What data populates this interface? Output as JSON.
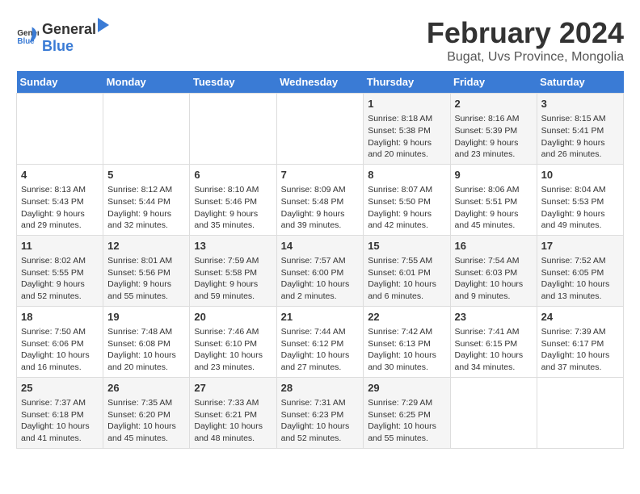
{
  "logo": {
    "general": "General",
    "blue": "Blue"
  },
  "title": "February 2024",
  "subtitle": "Bugat, Uvs Province, Mongolia",
  "days_of_week": [
    "Sunday",
    "Monday",
    "Tuesday",
    "Wednesday",
    "Thursday",
    "Friday",
    "Saturday"
  ],
  "weeks": [
    [
      {
        "day": "",
        "info": ""
      },
      {
        "day": "",
        "info": ""
      },
      {
        "day": "",
        "info": ""
      },
      {
        "day": "",
        "info": ""
      },
      {
        "day": "1",
        "info": "Sunrise: 8:18 AM\nSunset: 5:38 PM\nDaylight: 9 hours and 20 minutes."
      },
      {
        "day": "2",
        "info": "Sunrise: 8:16 AM\nSunset: 5:39 PM\nDaylight: 9 hours and 23 minutes."
      },
      {
        "day": "3",
        "info": "Sunrise: 8:15 AM\nSunset: 5:41 PM\nDaylight: 9 hours and 26 minutes."
      }
    ],
    [
      {
        "day": "4",
        "info": "Sunrise: 8:13 AM\nSunset: 5:43 PM\nDaylight: 9 hours and 29 minutes."
      },
      {
        "day": "5",
        "info": "Sunrise: 8:12 AM\nSunset: 5:44 PM\nDaylight: 9 hours and 32 minutes."
      },
      {
        "day": "6",
        "info": "Sunrise: 8:10 AM\nSunset: 5:46 PM\nDaylight: 9 hours and 35 minutes."
      },
      {
        "day": "7",
        "info": "Sunrise: 8:09 AM\nSunset: 5:48 PM\nDaylight: 9 hours and 39 minutes."
      },
      {
        "day": "8",
        "info": "Sunrise: 8:07 AM\nSunset: 5:50 PM\nDaylight: 9 hours and 42 minutes."
      },
      {
        "day": "9",
        "info": "Sunrise: 8:06 AM\nSunset: 5:51 PM\nDaylight: 9 hours and 45 minutes."
      },
      {
        "day": "10",
        "info": "Sunrise: 8:04 AM\nSunset: 5:53 PM\nDaylight: 9 hours and 49 minutes."
      }
    ],
    [
      {
        "day": "11",
        "info": "Sunrise: 8:02 AM\nSunset: 5:55 PM\nDaylight: 9 hours and 52 minutes."
      },
      {
        "day": "12",
        "info": "Sunrise: 8:01 AM\nSunset: 5:56 PM\nDaylight: 9 hours and 55 minutes."
      },
      {
        "day": "13",
        "info": "Sunrise: 7:59 AM\nSunset: 5:58 PM\nDaylight: 9 hours and 59 minutes."
      },
      {
        "day": "14",
        "info": "Sunrise: 7:57 AM\nSunset: 6:00 PM\nDaylight: 10 hours and 2 minutes."
      },
      {
        "day": "15",
        "info": "Sunrise: 7:55 AM\nSunset: 6:01 PM\nDaylight: 10 hours and 6 minutes."
      },
      {
        "day": "16",
        "info": "Sunrise: 7:54 AM\nSunset: 6:03 PM\nDaylight: 10 hours and 9 minutes."
      },
      {
        "day": "17",
        "info": "Sunrise: 7:52 AM\nSunset: 6:05 PM\nDaylight: 10 hours and 13 minutes."
      }
    ],
    [
      {
        "day": "18",
        "info": "Sunrise: 7:50 AM\nSunset: 6:06 PM\nDaylight: 10 hours and 16 minutes."
      },
      {
        "day": "19",
        "info": "Sunrise: 7:48 AM\nSunset: 6:08 PM\nDaylight: 10 hours and 20 minutes."
      },
      {
        "day": "20",
        "info": "Sunrise: 7:46 AM\nSunset: 6:10 PM\nDaylight: 10 hours and 23 minutes."
      },
      {
        "day": "21",
        "info": "Sunrise: 7:44 AM\nSunset: 6:12 PM\nDaylight: 10 hours and 27 minutes."
      },
      {
        "day": "22",
        "info": "Sunrise: 7:42 AM\nSunset: 6:13 PM\nDaylight: 10 hours and 30 minutes."
      },
      {
        "day": "23",
        "info": "Sunrise: 7:41 AM\nSunset: 6:15 PM\nDaylight: 10 hours and 34 minutes."
      },
      {
        "day": "24",
        "info": "Sunrise: 7:39 AM\nSunset: 6:17 PM\nDaylight: 10 hours and 37 minutes."
      }
    ],
    [
      {
        "day": "25",
        "info": "Sunrise: 7:37 AM\nSunset: 6:18 PM\nDaylight: 10 hours and 41 minutes."
      },
      {
        "day": "26",
        "info": "Sunrise: 7:35 AM\nSunset: 6:20 PM\nDaylight: 10 hours and 45 minutes."
      },
      {
        "day": "27",
        "info": "Sunrise: 7:33 AM\nSunset: 6:21 PM\nDaylight: 10 hours and 48 minutes."
      },
      {
        "day": "28",
        "info": "Sunrise: 7:31 AM\nSunset: 6:23 PM\nDaylight: 10 hours and 52 minutes."
      },
      {
        "day": "29",
        "info": "Sunrise: 7:29 AM\nSunset: 6:25 PM\nDaylight: 10 hours and 55 minutes."
      },
      {
        "day": "",
        "info": ""
      },
      {
        "day": "",
        "info": ""
      }
    ]
  ]
}
